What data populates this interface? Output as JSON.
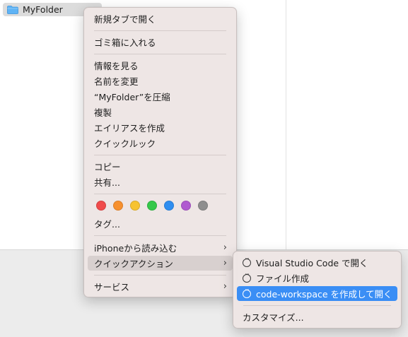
{
  "finder": {
    "folder_name": "MyFolder"
  },
  "context_menu": {
    "items": {
      "open_new_tab": "新規タブで開く",
      "move_to_trash": "ゴミ箱に入れる",
      "get_info": "情報を見る",
      "rename": "名前を変更",
      "compress": "“MyFolder”を圧縮",
      "duplicate": "複製",
      "make_alias": "エイリアスを作成",
      "quick_look": "クイックルック",
      "copy": "コピー",
      "share": "共有...",
      "tags": "タグ...",
      "import_from_iphone": "iPhoneから読み込む",
      "quick_actions": "クイックアクション",
      "services": "サービス"
    },
    "tag_colors": [
      "#f04b4b",
      "#f7902e",
      "#f7c330",
      "#35c84a",
      "#2f8ef0",
      "#b05ad0",
      "#8e8e8e"
    ]
  },
  "submenu": {
    "items": {
      "open_vscode": "Visual Studio Code で開く",
      "create_file": "ファイル作成",
      "create_workspace": "code-workspace を作成して開く",
      "customize": "カスタマイズ..."
    }
  },
  "colors": {
    "highlight": "#3a8ef5",
    "menu_bg": "#eee5e4"
  }
}
